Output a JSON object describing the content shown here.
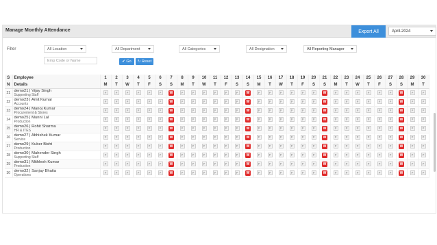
{
  "header": {
    "title": "Manage Monthly Attendance",
    "export_label": "Export All",
    "month_value": "April-2024"
  },
  "filters": {
    "label": "Filter",
    "location": "All Location",
    "department": "All Department",
    "categories": "All Categories",
    "designation": "All Designation",
    "reporting_manager": "All Reporting Manager",
    "search_placeholder": "Emp Code or Name",
    "go_label": "Go",
    "reset_label": "Reset"
  },
  "table": {
    "sn_header_1": "S",
    "sn_header_2": "N",
    "emp_header_1": "Employee",
    "emp_header_2": "Details",
    "days": [
      "1",
      "2",
      "3",
      "4",
      "5",
      "6",
      "7",
      "8",
      "9",
      "10",
      "11",
      "12",
      "13",
      "14",
      "15",
      "16",
      "17",
      "18",
      "19",
      "20",
      "21",
      "22",
      "23",
      "24",
      "25",
      "26",
      "27",
      "28",
      "29",
      "30"
    ],
    "weekdays": [
      "M",
      "T",
      "W",
      "T",
      "F",
      "S",
      "S",
      "M",
      "T",
      "W",
      "T",
      "F",
      "S",
      "S",
      "M",
      "T",
      "W",
      "T",
      "F",
      "S",
      "S",
      "M",
      "T",
      "W",
      "T",
      "F",
      "S",
      "S",
      "M",
      "T"
    ],
    "weekoff_days": [
      7,
      14,
      21,
      28
    ],
    "present_mark": "P",
    "weekoff_mark": "W",
    "rows": [
      {
        "sn": "21",
        "name": "demo21 | Vijay Singh",
        "dept": "Supporting Staff"
      },
      {
        "sn": "22",
        "name": "demo23 | Amit Kumar",
        "dept": "Accounts"
      },
      {
        "sn": "23",
        "name": "demo24 | Manoj Kumar",
        "dept": "Procurement & Stores"
      },
      {
        "sn": "24",
        "name": "demo25 | Munni Lal",
        "dept": "Production"
      },
      {
        "sn": "25",
        "name": "demo26 | Rohit Sharma",
        "dept": "HR & ITES"
      },
      {
        "sn": "26",
        "name": "demo27 | Abhishek Kumar",
        "dept": "Service"
      },
      {
        "sn": "27",
        "name": "demo29 | Kuber Bisht",
        "dept": "Production"
      },
      {
        "sn": "28",
        "name": "demo30 | Mahender Singh",
        "dept": "Supporting Staff"
      },
      {
        "sn": "29",
        "name": "demo31 | Mithlesh Kumar",
        "dept": "Production"
      },
      {
        "sn": "30",
        "name": "demo32 | Sanjay  Bhatia",
        "dept": "Operations"
      }
    ]
  },
  "colors": {
    "accent": "#3d8fdb",
    "weekoff": "#e02b2b"
  }
}
